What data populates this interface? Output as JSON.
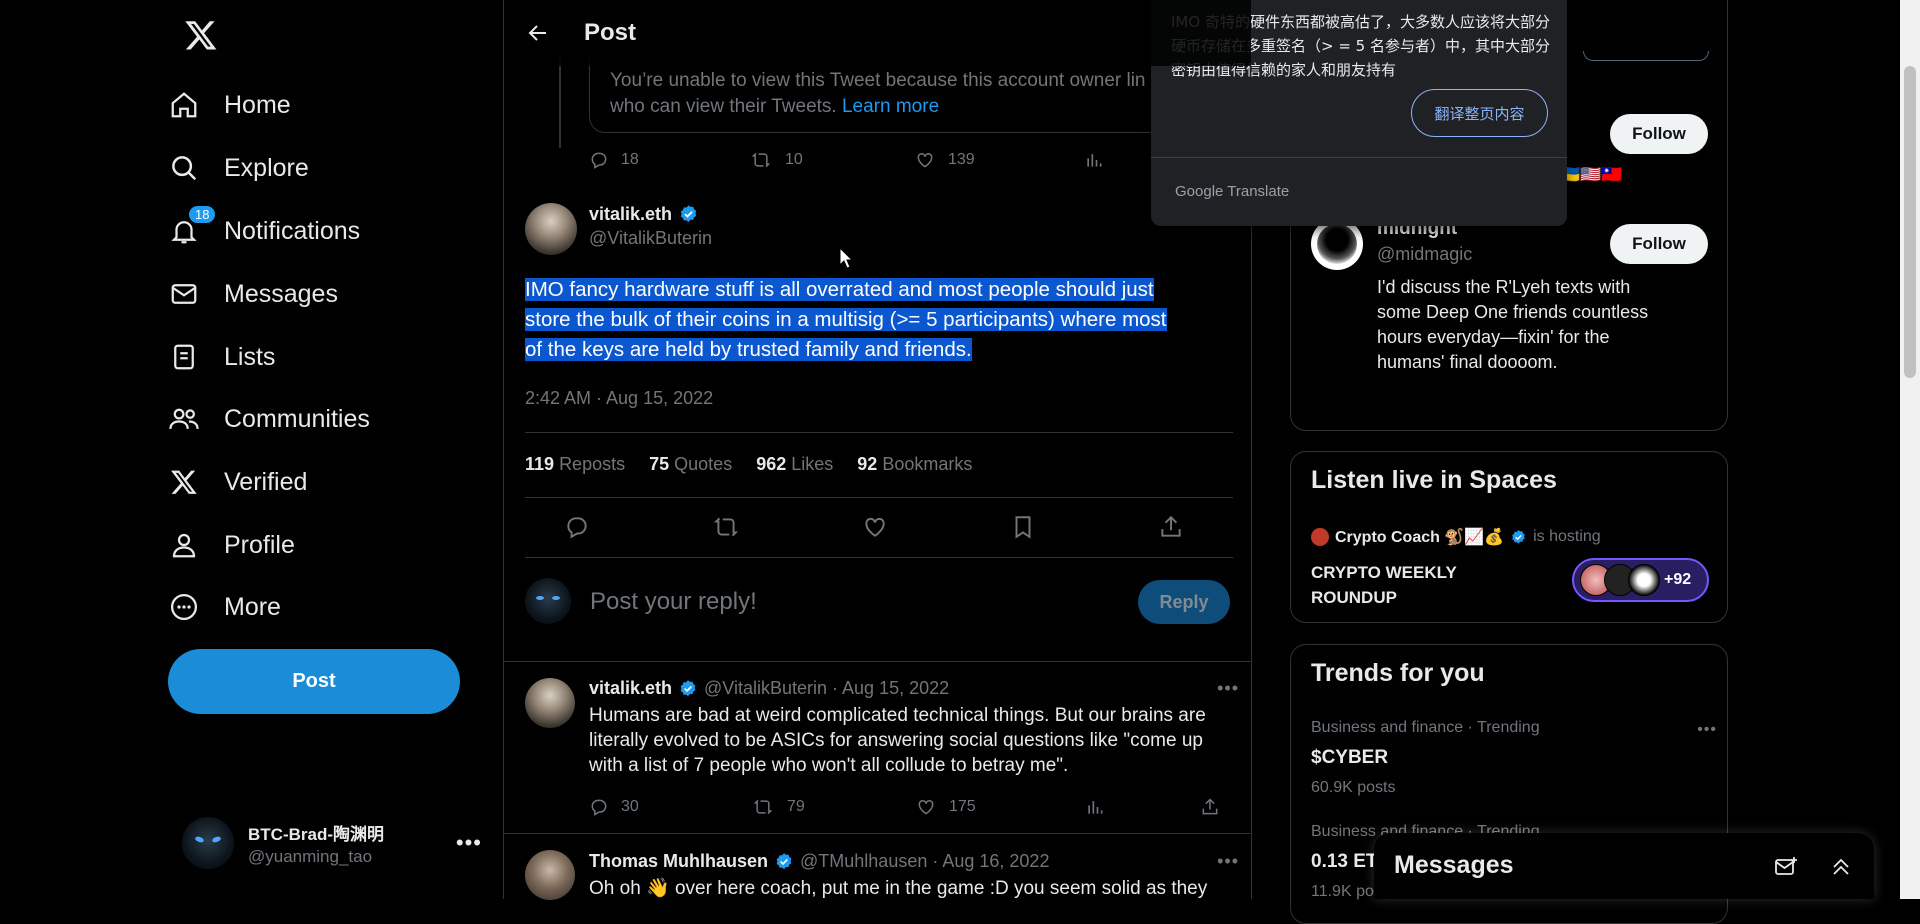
{
  "nav": {
    "items": [
      {
        "label": "Home",
        "icon": "home-icon"
      },
      {
        "label": "Explore",
        "icon": "search-icon"
      },
      {
        "label": "Notifications",
        "icon": "bell-icon",
        "badge": "18"
      },
      {
        "label": "Messages",
        "icon": "mail-icon"
      },
      {
        "label": "Lists",
        "icon": "list-icon"
      },
      {
        "label": "Communities",
        "icon": "people-icon"
      },
      {
        "label": "Verified",
        "icon": "x-logo-icon"
      },
      {
        "label": "Profile",
        "icon": "person-icon"
      },
      {
        "label": "More",
        "icon": "more-circle-icon"
      }
    ],
    "post_label": "Post",
    "account": {
      "name": "BTC-Brad-陶渊明",
      "handle": "@yuanming_tao"
    }
  },
  "main": {
    "header_title": "Post",
    "withheld": {
      "text": "You’re unable to view this Tweet because this account owner lin",
      "text2": "who can view their Tweets. ",
      "link": "Learn more"
    },
    "quoted_actions": {
      "replies": "18",
      "reposts": "10",
      "likes": "139"
    },
    "tweet": {
      "name": "vitalik.eth",
      "handle": "@VitalikButerin",
      "line1": "IMO fancy hardware stuff is all overrated and most people should just ",
      "line2": "store the bulk of their coins in a multisig (>= 5 participants) where most ",
      "line3": "of the keys are held by trusted family and friends.",
      "timestamp": "2:42 AM · Aug 15, 2022",
      "stats": [
        {
          "num": "119",
          "label": "Reposts"
        },
        {
          "num": "75",
          "label": "Quotes"
        },
        {
          "num": "962",
          "label": "Likes"
        },
        {
          "num": "92",
          "label": "Bookmarks"
        }
      ]
    },
    "reply_box": {
      "placeholder": "Post your reply!",
      "button": "Reply"
    },
    "replies": [
      {
        "name": "vitalik.eth",
        "meta": "@VitalikButerin · Aug 15, 2022",
        "text": "Humans are bad at weird complicated technical things. But our brains are literally evolved to be ASICs for answering social questions like \"come up with a list of 7 people who won't all collude to betray me\".",
        "replies": "30",
        "reposts": "79",
        "likes": "175"
      },
      {
        "name": "Thomas Muhlhausen",
        "meta": "@TMuhlhausen · Aug 16, 2022",
        "text": "Oh oh 👋 over here coach, put me in the game :D you seem solid as they"
      }
    ]
  },
  "right": {
    "follow_label": "Follow",
    "flags": "🇺🇦🇺🇸🇹🇼",
    "suggestion": {
      "name": "midnight",
      "handle": "@midmagic",
      "bio": "I'd discuss the R'Lyeh texts with some Deep One friends countless hours everyday—fixin' for the humans' final doooom."
    },
    "spaces": {
      "title": "Listen live in Spaces",
      "host": "Crypto Coach 🐒📈💰",
      "hosting": "is hosting",
      "space_name": "CRYPTO WEEKLY ROUNDUP",
      "listeners": "+92"
    },
    "trends": {
      "title": "Trends for you",
      "items": [
        {
          "context": "Business and finance · Trending",
          "topic": "$CYBER",
          "posts": "60.9K posts"
        },
        {
          "context": "Business and finance · Trending",
          "topic": "0.13 ET",
          "posts": "11.9K po"
        }
      ]
    }
  },
  "translate": {
    "text": "IMO 奇特的硬件东西都被高估了，大多数人应该将大部分硬币存储在多重签名（> = 5 名参与者）中，其中大部分密钥由值得信赖的家人和朋友持有",
    "button": "翻译整页内容",
    "footer": "Google Translate"
  },
  "messages_drawer": {
    "title": "Messages"
  },
  "colors": {
    "accent": "#1d9bf0",
    "post_button": "#1a8cd8",
    "selection": "#0b57d0"
  }
}
